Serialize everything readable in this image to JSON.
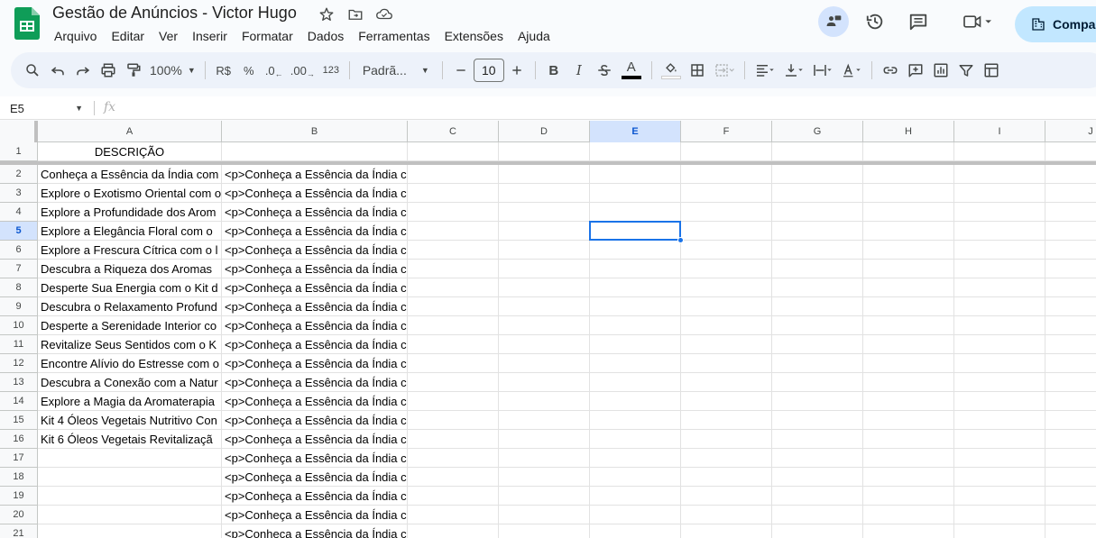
{
  "document": {
    "title": "Gestão de Anúncios - Victor Hugo"
  },
  "menu": [
    "Arquivo",
    "Editar",
    "Ver",
    "Inserir",
    "Formatar",
    "Dados",
    "Ferramentas",
    "Extensões",
    "Ajuda"
  ],
  "share_label": "Compa",
  "toolbar": {
    "zoom": "100%",
    "currency": "R$",
    "percent": "%",
    "dec_decrease": ".0",
    "dec_increase": ".00",
    "number_format": "123",
    "font_name": "Padrã...",
    "font_size": "10"
  },
  "formula_bar": {
    "name_box": "E5",
    "fx": "fx",
    "value": ""
  },
  "columns": [
    "A",
    "B",
    "C",
    "D",
    "E",
    "F",
    "G",
    "H",
    "I",
    "J"
  ],
  "selected_cell": {
    "column": "E",
    "row": "5"
  },
  "rows": [
    {
      "n": "1",
      "a": "DESCRIÇÃO",
      "b": ""
    },
    {
      "n": "2",
      "a": "Conheça a Essência da Índia com",
      "b": "<p>Conheça a Essência da Índia c"
    },
    {
      "n": "3",
      "a": "Explore o Exotismo Oriental com o",
      "b": "<p>Conheça a Essência da Índia c"
    },
    {
      "n": "4",
      "a": "Explore a Profundidade dos Arom",
      "b": "<p>Conheça a Essência da Índia c"
    },
    {
      "n": "5",
      "a": "Explore a Elegância Floral com o",
      "b": "<p>Conheça a Essência da Índia c"
    },
    {
      "n": "6",
      "a": "Explore a Frescura Cítrica com o l",
      "b": "<p>Conheça a Essência da Índia c"
    },
    {
      "n": "7",
      "a": "Descubra a Riqueza dos Aromas",
      "b": "<p>Conheça a Essência da Índia c"
    },
    {
      "n": "8",
      "a": "Desperte Sua Energia com o Kit d",
      "b": "<p>Conheça a Essência da Índia c"
    },
    {
      "n": "9",
      "a": "Descubra o Relaxamento Profund",
      "b": "<p>Conheça a Essência da Índia c"
    },
    {
      "n": "10",
      "a": "Desperte a Serenidade Interior co",
      "b": "<p>Conheça a Essência da Índia c"
    },
    {
      "n": "11",
      "a": "Revitalize Seus Sentidos com o K",
      "b": "<p>Conheça a Essência da Índia c"
    },
    {
      "n": "12",
      "a": "Encontre Alívio do Estresse com o",
      "b": "<p>Conheça a Essência da Índia c"
    },
    {
      "n": "13",
      "a": "Descubra a Conexão com a Natur",
      "b": "<p>Conheça a Essência da Índia c"
    },
    {
      "n": "14",
      "a": "Explore a Magia da Aromaterapia",
      "b": "<p>Conheça a Essência da Índia c"
    },
    {
      "n": "15",
      "a": "Kit 4 Óleos Vegetais Nutritivo Con",
      "b": "<p>Conheça a Essência da Índia c"
    },
    {
      "n": "16",
      "a": "Kit 6 Óleos Vegetais Revitalizaçã",
      "b": "<p>Conheça a Essência da Índia c"
    },
    {
      "n": "17",
      "a": "",
      "b": "<p>Conheça a Essência da Índia c"
    },
    {
      "n": "18",
      "a": "",
      "b": "<p>Conheça a Essência da Índia c"
    },
    {
      "n": "19",
      "a": "",
      "b": "<p>Conheça a Essência da Índia c"
    },
    {
      "n": "20",
      "a": "",
      "b": "<p>Conheça a Essência da Índia c"
    },
    {
      "n": "21",
      "a": "",
      "b": "<p>Conheça a Essência da Índia c"
    }
  ]
}
